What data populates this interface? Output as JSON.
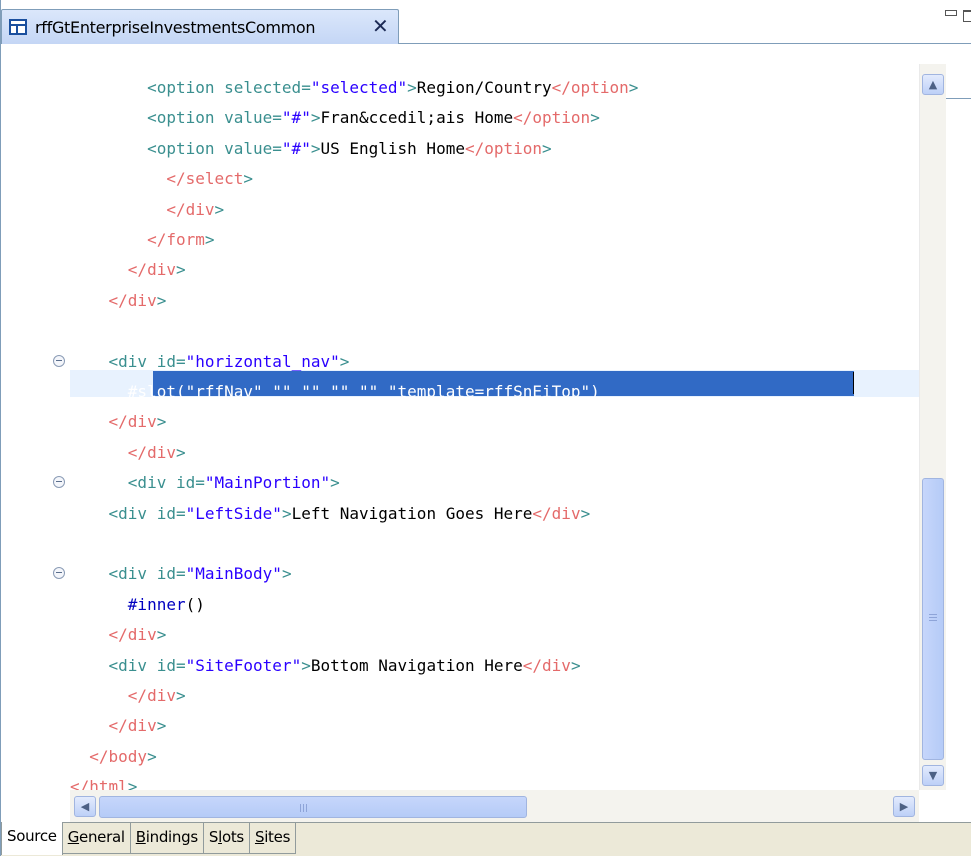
{
  "editor_tab": {
    "title": "rffGtEnterpriseInvestmentsCommon",
    "icon": "html-file-icon",
    "close_icon": "close-icon"
  },
  "code_lines": [
    {
      "indent": "        ",
      "parts": [
        [
          "tag",
          "<option "
        ],
        [
          "attr",
          "selected="
        ],
        [
          "str",
          "\"selected\""
        ],
        [
          "tag",
          ">"
        ],
        [
          "txt",
          "Region/Country"
        ],
        [
          "ctag",
          "</option"
        ],
        [
          "tag",
          ">"
        ]
      ]
    },
    {
      "indent": "        ",
      "parts": [
        [
          "tag",
          "<option "
        ],
        [
          "attr",
          "value="
        ],
        [
          "str",
          "\"#\""
        ],
        [
          "tag",
          ">"
        ],
        [
          "txt",
          "Fran&ccedil;ais Home"
        ],
        [
          "ctag",
          "</option"
        ],
        [
          "tag",
          ">"
        ]
      ]
    },
    {
      "indent": "        ",
      "parts": [
        [
          "tag",
          "<option "
        ],
        [
          "attr",
          "value="
        ],
        [
          "str",
          "\"#\""
        ],
        [
          "tag",
          ">"
        ],
        [
          "txt",
          "US English Home"
        ],
        [
          "ctag",
          "</option"
        ],
        [
          "tag",
          ">"
        ]
      ]
    },
    {
      "indent": "          ",
      "parts": [
        [
          "ctag",
          "</select"
        ],
        [
          "tag",
          ">"
        ]
      ]
    },
    {
      "indent": "          ",
      "parts": [
        [
          "ctag",
          "</div"
        ],
        [
          "tag",
          ">"
        ]
      ]
    },
    {
      "indent": "        ",
      "parts": [
        [
          "ctag",
          "</form"
        ],
        [
          "tag",
          ">"
        ]
      ]
    },
    {
      "indent": "      ",
      "parts": [
        [
          "ctag",
          "</div"
        ],
        [
          "tag",
          ">"
        ]
      ]
    },
    {
      "indent": "    ",
      "parts": [
        [
          "ctag",
          "</div"
        ],
        [
          "tag",
          ">"
        ]
      ]
    },
    {
      "indent": "",
      "parts": []
    },
    {
      "indent": "    ",
      "fold": true,
      "parts": [
        [
          "tag",
          "<div "
        ],
        [
          "attr",
          "id="
        ],
        [
          "str",
          "\"horizontal_nav\""
        ],
        [
          "tag",
          ">"
        ]
      ]
    },
    {
      "indent": "      ",
      "selected": true,
      "parts": [
        [
          "kw",
          "#slot"
        ],
        [
          "txt",
          "(\"rffNav\" \"\" \"\" \"\" \"\" \"template=rffSnEiTop\")"
        ]
      ]
    },
    {
      "indent": "    ",
      "parts": [
        [
          "ctag",
          "</div"
        ],
        [
          "tag",
          ">"
        ]
      ]
    },
    {
      "indent": "      ",
      "parts": [
        [
          "ctag",
          "</div"
        ],
        [
          "tag",
          ">"
        ]
      ]
    },
    {
      "indent": "      ",
      "fold": true,
      "parts": [
        [
          "tag",
          "<div "
        ],
        [
          "attr",
          "id="
        ],
        [
          "str",
          "\"MainPortion\""
        ],
        [
          "tag",
          ">"
        ]
      ]
    },
    {
      "indent": "    ",
      "parts": [
        [
          "tag",
          "<div "
        ],
        [
          "attr",
          "id="
        ],
        [
          "str",
          "\"LeftSide\""
        ],
        [
          "tag",
          ">"
        ],
        [
          "txt",
          "Left Navigation Goes Here"
        ],
        [
          "ctag",
          "</div"
        ],
        [
          "tag",
          ">"
        ]
      ]
    },
    {
      "indent": "",
      "parts": []
    },
    {
      "indent": "    ",
      "fold": true,
      "parts": [
        [
          "tag",
          "<div "
        ],
        [
          "attr",
          "id="
        ],
        [
          "str",
          "\"MainBody\""
        ],
        [
          "tag",
          ">"
        ]
      ]
    },
    {
      "indent": "      ",
      "parts": [
        [
          "kw",
          "#inner"
        ],
        [
          "txt",
          "()"
        ]
      ]
    },
    {
      "indent": "    ",
      "parts": [
        [
          "ctag",
          "</div"
        ],
        [
          "tag",
          ">"
        ]
      ]
    },
    {
      "indent": "    ",
      "parts": [
        [
          "tag",
          "<div "
        ],
        [
          "attr",
          "id="
        ],
        [
          "str",
          "\"SiteFooter\""
        ],
        [
          "tag",
          ">"
        ],
        [
          "txt",
          "Bottom Navigation Here"
        ],
        [
          "ctag",
          "</div"
        ],
        [
          "tag",
          ">"
        ]
      ]
    },
    {
      "indent": "      ",
      "parts": [
        [
          "ctag",
          "</div"
        ],
        [
          "tag",
          ">"
        ]
      ]
    },
    {
      "indent": "    ",
      "parts": [
        [
          "ctag",
          "</div"
        ],
        [
          "tag",
          ">"
        ]
      ]
    },
    {
      "indent": "  ",
      "parts": [
        [
          "ctag",
          "</body"
        ],
        [
          "tag",
          ">"
        ]
      ]
    },
    {
      "indent": "",
      "parts": [
        [
          "ctag",
          "</html"
        ],
        [
          "tag",
          ">"
        ]
      ]
    }
  ],
  "scrollbars": {
    "up_arrow": "▲",
    "down_arrow": "▼",
    "left_arrow": "◀",
    "right_arrow": "▶"
  },
  "page_tabs": [
    {
      "label": "Source",
      "underline": "",
      "active": true
    },
    {
      "label": "General",
      "underline": "G",
      "active": false
    },
    {
      "label": "Bindings",
      "underline": "B",
      "active": false
    },
    {
      "label": "Slots",
      "underline": "l",
      "active": false
    },
    {
      "label": "Sites",
      "underline": "S",
      "active": false
    }
  ],
  "colors": {
    "tag": "#3a8f8f",
    "close_tag": "#e46a6a",
    "string": "#2a00ff",
    "selection": "#316ac5",
    "current_line": "#e8f2fe"
  }
}
